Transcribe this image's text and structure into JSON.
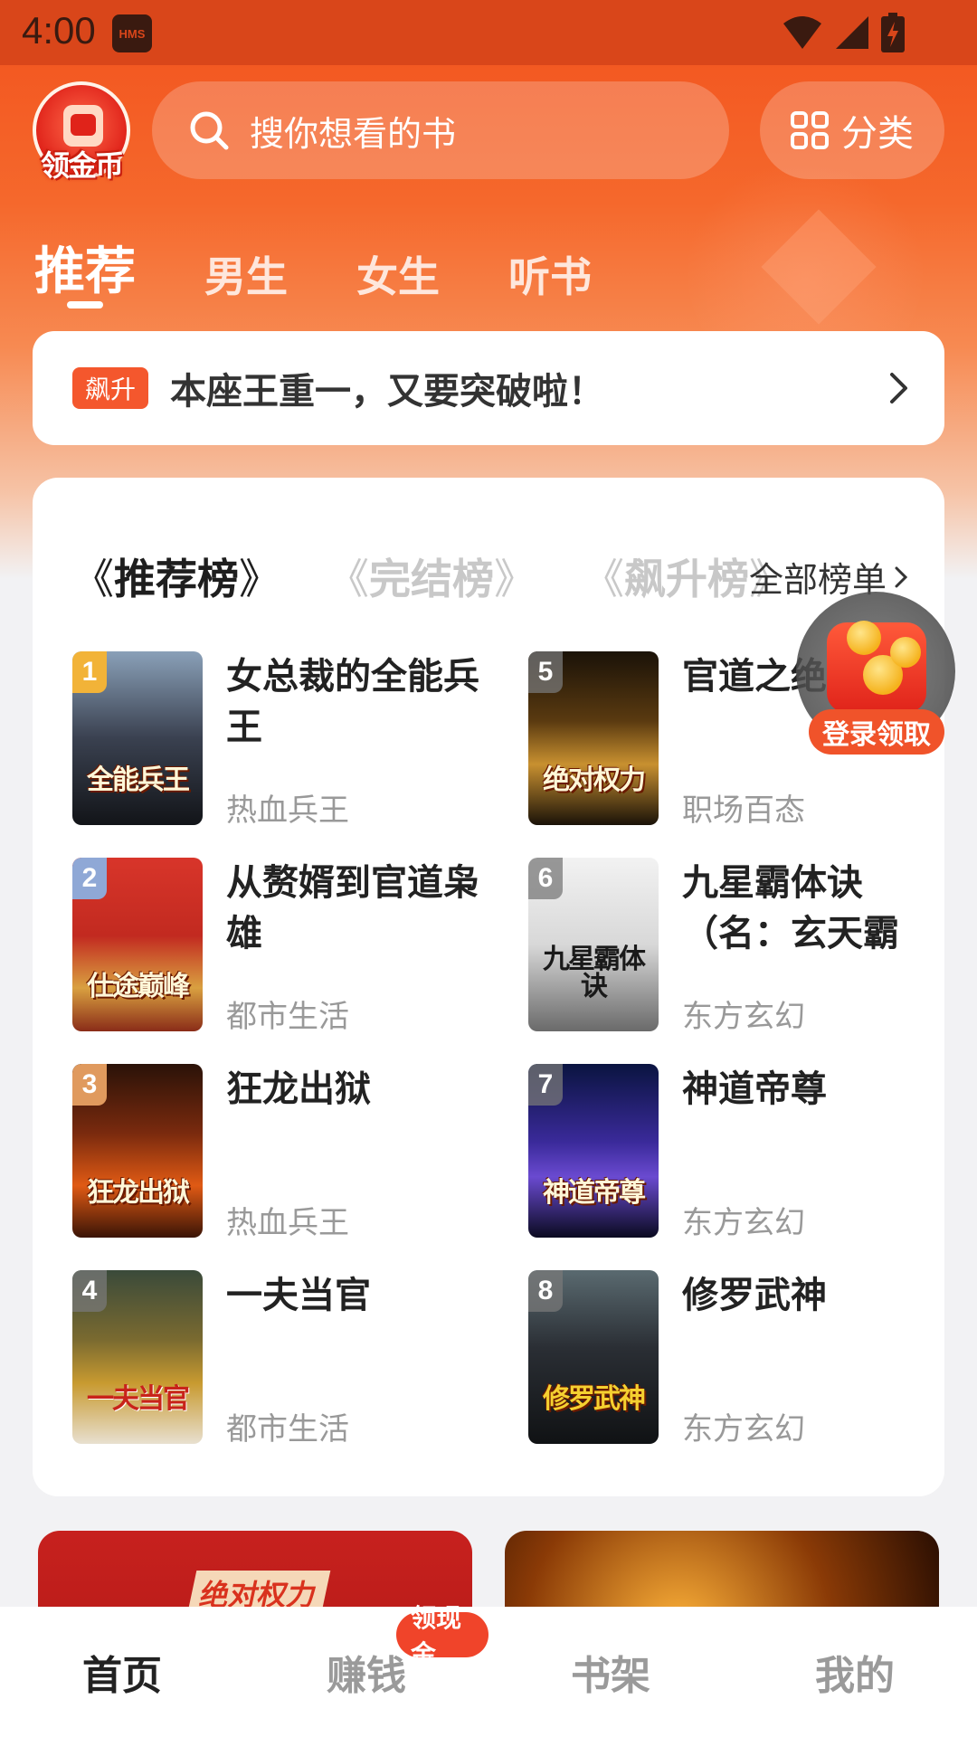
{
  "status_bar": {
    "time": "4:00",
    "hms_badge": "HMS"
  },
  "header": {
    "coin_label": "领金币",
    "search_placeholder": "搜你想看的书",
    "category_label": "分类"
  },
  "tabs": [
    {
      "label": "推荐",
      "active": true
    },
    {
      "label": "男生",
      "active": false
    },
    {
      "label": "女生",
      "active": false
    },
    {
      "label": "听书",
      "active": false
    }
  ],
  "notice": {
    "badge": "飙升",
    "text": "本座王重一，又要突破啦！"
  },
  "rank": {
    "tabs": [
      {
        "label": "推荐榜",
        "active": true
      },
      {
        "label": "完结榜",
        "active": false
      },
      {
        "label": "飙升榜",
        "active": false
      }
    ],
    "all_label": "全部榜单",
    "books": [
      {
        "rank": "1",
        "title": "女总裁的全能兵王",
        "genre": "热血兵王",
        "cover_text": "全能兵王"
      },
      {
        "rank": "2",
        "title": "从赘婿到官道枭雄",
        "genre": "都市生活",
        "cover_text": "仕途巅峰"
      },
      {
        "rank": "3",
        "title": "狂龙出狱",
        "genre": "热血兵王",
        "cover_text": "狂龙出狱"
      },
      {
        "rank": "4",
        "title": "一夫当官",
        "genre": "都市生活",
        "cover_text": "一夫当官"
      },
      {
        "rank": "5",
        "title": "官道之绝",
        "genre": "职场百态",
        "cover_text": "绝对权力"
      },
      {
        "rank": "6",
        "title": "九星霸体诀（名：玄天霸体",
        "genre": "东方玄幻",
        "cover_text": "九星霸体诀"
      },
      {
        "rank": "7",
        "title": "神道帝尊",
        "genre": "东方玄幻",
        "cover_text": "神道帝尊"
      },
      {
        "rank": "8",
        "title": "修罗武神",
        "genre": "东方玄幻",
        "cover_text": "修罗武神"
      }
    ]
  },
  "float_login": {
    "label": "登录领取"
  },
  "banners": {
    "left_title": "绝对权力"
  },
  "bottom_nav": {
    "items": [
      {
        "label": "首页",
        "active": true
      },
      {
        "label": "赚钱",
        "active": false
      },
      {
        "label": "书架",
        "active": false
      },
      {
        "label": "我的",
        "active": false
      }
    ],
    "badge": "领现金"
  },
  "colors": {
    "brand": "#f2521d",
    "accent_badge": "#f0442a",
    "card_bg": "#ffffff",
    "page_bg": "#f2f2f4"
  }
}
